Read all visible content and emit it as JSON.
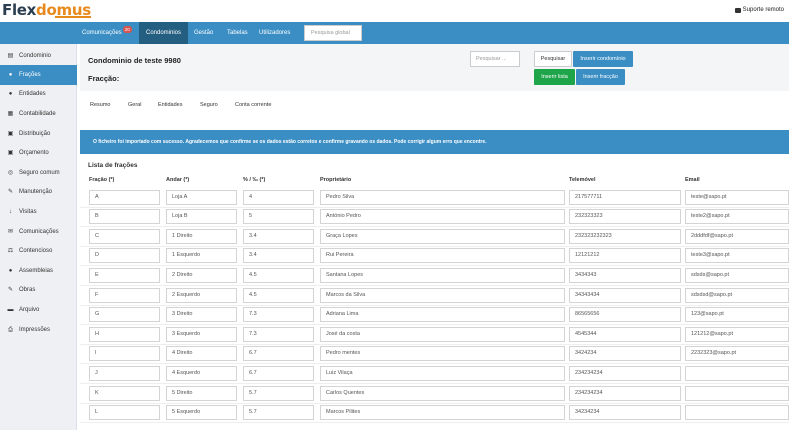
{
  "brand": {
    "part1": "Flex",
    "part2": "domus"
  },
  "top_right": {
    "remote_label": "Suporte remoto"
  },
  "nav": {
    "items": [
      {
        "label": "Comunicações",
        "badge": "20"
      },
      {
        "label": "Condominios"
      },
      {
        "label": "Gestão"
      },
      {
        "label": "Tabelas"
      },
      {
        "label": "Utilizadores"
      }
    ],
    "search_placeholder": "Pesquisa global"
  },
  "sidebar": {
    "items": [
      {
        "label": "Condominio",
        "icon": "building-icon"
      },
      {
        "label": "Frações",
        "icon": "user-icon"
      },
      {
        "label": "Entidades",
        "icon": "users-icon"
      },
      {
        "label": "Contabilidade",
        "icon": "ledger-icon"
      },
      {
        "label": "Distribuição",
        "icon": "calendar-icon"
      },
      {
        "label": "Orçamento",
        "icon": "calendar-icon"
      },
      {
        "label": "Seguro comum",
        "icon": "shield-icon"
      },
      {
        "label": "Manutenção",
        "icon": "wrench-icon"
      },
      {
        "label": "Visitas",
        "icon": "download-icon"
      },
      {
        "label": "Comunicações",
        "icon": "envelope-icon"
      },
      {
        "label": "Contencioso",
        "icon": "scales-icon"
      },
      {
        "label": "Assembleias",
        "icon": "chat-icon"
      },
      {
        "label": "Obras",
        "icon": "tools-icon"
      },
      {
        "label": "Arquivo",
        "icon": "folder-icon"
      },
      {
        "label": "Impressões",
        "icon": "printer-icon"
      }
    ]
  },
  "header": {
    "title": "Condominio de teste 9980",
    "subtitle": "Fracção:",
    "search_placeholder": "Pesquisar ...",
    "search_button": "Pesquisar",
    "insert_condo_button": "Inserir condomínio",
    "insert_list_button": "Inserir lista",
    "insert_fraction_button": "Inserir fracção"
  },
  "tabs": [
    "Resumo",
    "Geral",
    "Entidades",
    "Seguro",
    "Conta corrente"
  ],
  "alert": "O ficheiro foi importado com sucesso. Agradecemos que confirme se os dados estão corretos e confirme gravando os dados. Pode corrigir algum erro que encontre.",
  "list": {
    "title": "Lista de frações",
    "columns": [
      "Fração (*)",
      "Andar (*)",
      "% / ‰ (*)",
      "Proprietário",
      "Telemóvel",
      "Email"
    ],
    "rows": [
      [
        "A",
        "Loja A",
        "4",
        "Pedro Silva",
        "217577711",
        "teste@sapo.pt"
      ],
      [
        "B",
        "Loja B",
        "5",
        "António Pedro",
        "232323323",
        "teste2@sapo.pt"
      ],
      [
        "C",
        "1 Direito",
        "3.4",
        "Graça Lopes",
        "232323232323",
        "2dddfdf@sapo.pt"
      ],
      [
        "D",
        "1 Esquerdo",
        "3.4",
        "Rui Pereira",
        "12121212",
        "teste3@sapo.pt"
      ],
      [
        "E",
        "2 Direito",
        "4.5",
        "Santana Lopes",
        "3434343",
        "sdsds@sapo.pt"
      ],
      [
        "F",
        "2 Esquerdo",
        "4.5",
        "Marcos da Silva",
        "34343434",
        "sdsdsd@sapo.pt"
      ],
      [
        "G",
        "3 Direito",
        "7.3",
        "Adriana Lima",
        "86565656",
        "123@sapo.pt"
      ],
      [
        "H",
        "3 Esquerdo",
        "7.3",
        "José da costa",
        "4545344",
        "121212@sapo.pt"
      ],
      [
        "I",
        "4 Direito",
        "6.7",
        "Pedro mentes",
        "3424234",
        "2232323@sapo.pt"
      ],
      [
        "J",
        "4 Esquerdo",
        "6.7",
        "Luiz Vilaça",
        "234234234",
        ""
      ],
      [
        "K",
        "5 Direito",
        "5.7",
        "Carlos Quentes",
        "234234234",
        ""
      ],
      [
        "L",
        "5 Esquerdo",
        "5.7",
        "Marcos Pilites",
        "34234234",
        ""
      ]
    ]
  },
  "colors": {
    "nav_blue": "#3a8ec4",
    "nav_active": "#245e80",
    "green": "#1ea54a",
    "badge_red": "#d9534f",
    "brand_orange": "#e8891d",
    "brand_dark": "#2b3e50"
  }
}
